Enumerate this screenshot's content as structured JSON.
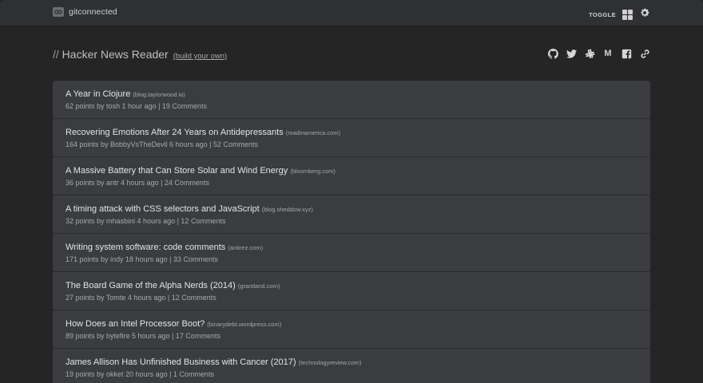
{
  "topbar": {
    "brand": "gitconnected",
    "toggle_label": "TOGGLE"
  },
  "header": {
    "slashes": "//",
    "title": "Hacker News Reader",
    "link": "(build your own)",
    "social_icons": [
      "github-icon",
      "twitter-icon",
      "slack-icon",
      "medium-icon",
      "facebook-icon",
      "link-icon"
    ]
  },
  "stories": [
    {
      "title": "A Year in Clojure",
      "domain": "(blog.taylorwood.io)",
      "meta": "62 points by tosh 1 hour ago | 19 Comments"
    },
    {
      "title": "Recovering Emotions After 24 Years on Antidepressants",
      "domain": "(madinamerica.com)",
      "meta": "164 points by BobbyVsTheDevil 6 hours ago | 52 Comments"
    },
    {
      "title": "A Massive Battery that Can Store Solar and Wind Energy",
      "domain": "(bloomberg.com)",
      "meta": "36 points by antr 4 hours ago | 24 Comments"
    },
    {
      "title": "A timing attack with CSS selectors and JavaScript",
      "domain": "(blog.sheddow.xyz)",
      "meta": "32 points by mhasbini 4 hours ago | 12 Comments"
    },
    {
      "title": "Writing system software: code comments",
      "domain": "(antirez.com)",
      "meta": "171 points by indy 18 hours ago | 33 Comments"
    },
    {
      "title": "The Board Game of the Alpha Nerds (2014)",
      "domain": "(grantland.com)",
      "meta": "27 points by Tomte 4 hours ago | 12 Comments"
    },
    {
      "title": "How Does an Intel Processor Boot?",
      "domain": "(binarydebt.wordpress.com)",
      "meta": "89 points by bytefire 5 hours ago | 17 Comments"
    },
    {
      "title": "James Allison Has Unfinished Business with Cancer (2017)",
      "domain": "(technologyreview.com)",
      "meta": "19 points by okket 20 hours ago | 1 Comments"
    }
  ]
}
